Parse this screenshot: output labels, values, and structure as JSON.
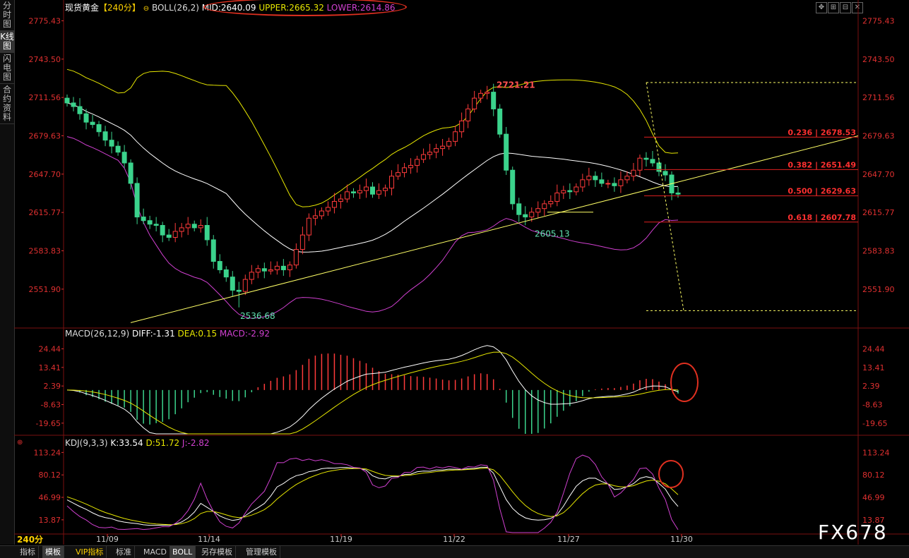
{
  "header": {
    "title": "现货黄金",
    "period": "【240分】",
    "indicator": "BOLL(26,2)",
    "mid": "MID:2640.09",
    "upper": "UPPER:2665.32",
    "lower": "LOWER:2614.86"
  },
  "sidebar": [
    "分时图",
    "K线图",
    "闪电图",
    "合约资料"
  ],
  "sidebar_active": 1,
  "toolbar_icons": [
    "move-icon",
    "zoom-in-icon",
    "zoom-out-icon",
    "close-icon"
  ],
  "period_tag": "240分",
  "watermark": "FX678",
  "bottom_tabs": [
    "指标",
    "模板",
    "VIP指标",
    "标准",
    "MACD",
    "BOLL",
    "另存模板",
    "管理模板"
  ],
  "colors": {
    "up": "#ff3b3b",
    "down": "#3bd38c",
    "upper": "#e6e600",
    "mid": "#ffffff",
    "lower": "#d040d0",
    "axis_red": "#e03030",
    "trend": "#ffff66",
    "annot": "#e03020"
  },
  "chart_data": [
    {
      "type": "candlestick",
      "title": "现货黄金 240分",
      "ylim": [
        2519.5,
        2781.0
      ],
      "y_ticks": [
        "2775.43",
        "2743.50",
        "2711.56",
        "2679.63",
        "2647.70",
        "2615.77",
        "2583.83",
        "2551.90"
      ],
      "x_ticks": [
        "11/09",
        "11/14",
        "11/19",
        "11/22",
        "11/27",
        "11/30"
      ],
      "annotations": {
        "high": "2721.21",
        "low1": "2536.68",
        "low2": "2605.13"
      },
      "fib_levels": [
        {
          "label": "0.236 | 2678.53",
          "value": 2678.53
        },
        {
          "label": "0.382 | 2651.49",
          "value": 2651.49
        },
        {
          "label": "0.500 | 2629.63",
          "value": 2629.63
        },
        {
          "label": "0.618 | 2607.78",
          "value": 2607.78
        }
      ],
      "closes": [
        2707,
        2704,
        2698,
        2691,
        2689,
        2683,
        2676,
        2671,
        2666,
        2657,
        2640,
        2612,
        2609,
        2606,
        2605,
        2597,
        2595,
        2600,
        2603,
        2606,
        2603,
        2605,
        2593,
        2575,
        2568,
        2562,
        2551,
        2550,
        2560,
        2566,
        2569,
        2567,
        2568,
        2571,
        2568,
        2572,
        2585,
        2597,
        2611,
        2613,
        2617,
        2620,
        2625,
        2627,
        2633,
        2632,
        2634,
        2637,
        2631,
        2634,
        2636,
        2646,
        2649,
        2653,
        2655,
        2660,
        2664,
        2666,
        2669,
        2671,
        2675,
        2683,
        2692,
        2702,
        2711,
        2715,
        2716,
        2702,
        2681,
        2651,
        2623,
        2614,
        2612,
        2616,
        2619,
        2623,
        2625,
        2632,
        2634,
        2633,
        2637,
        2643,
        2646,
        2643,
        2640,
        2640,
        2638,
        2643,
        2646,
        2651,
        2661,
        2660,
        2657,
        2650,
        2647,
        2632,
        2631
      ]
    },
    {
      "type": "macd",
      "title": "MACD(26,12,9)",
      "diff": "DIFF:-1.31",
      "dea": "DEA:0.15",
      "macd": "MACD:-2.92",
      "ylim": [
        -26.0,
        30.5
      ],
      "y_ticks": [
        "24.44",
        "13.41",
        "2.39",
        "-8.63",
        "-19.65"
      ]
    },
    {
      "type": "kdj",
      "title": "KDJ(9,3,3)",
      "k": "K:33.54",
      "d": "D:51.72",
      "j": "J:-2.82",
      "ylim": [
        -5.0,
        123.0
      ],
      "y_ticks": [
        "113.24",
        "80.12",
        "46.99",
        "13.87"
      ]
    }
  ]
}
